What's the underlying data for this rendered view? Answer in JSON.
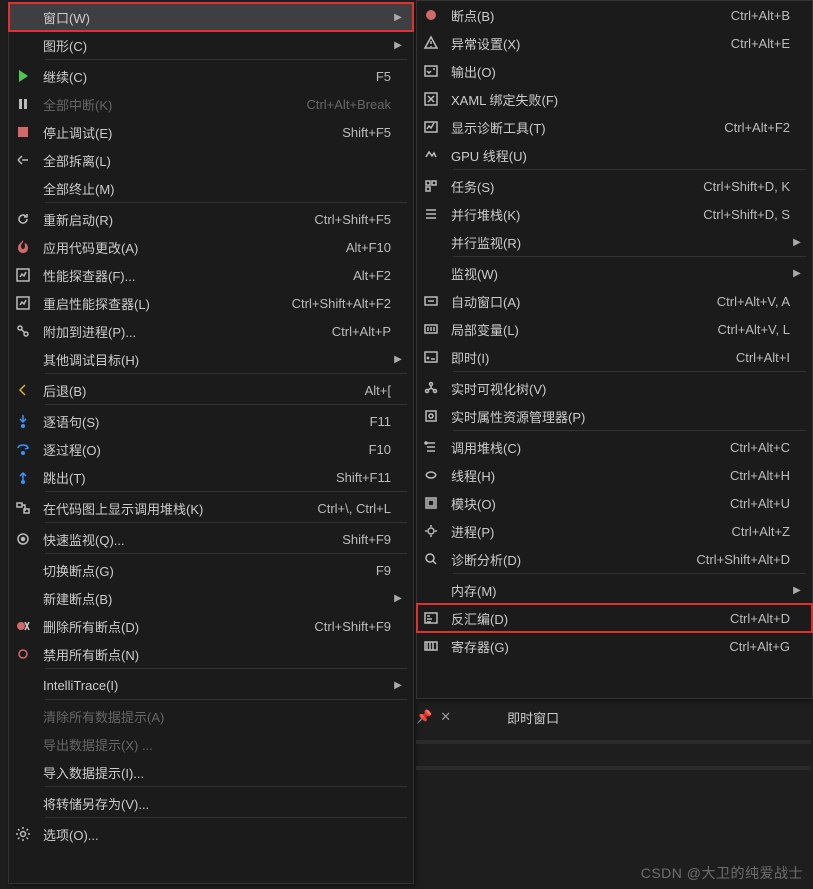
{
  "panel": {
    "title": "即时窗口"
  },
  "watermark": "CSDN @大卫的纯爱战士",
  "leftMenu": [
    {
      "id": "window",
      "label": "窗口(W)",
      "shortcut": "",
      "arrow": true,
      "icon": "",
      "hover": true,
      "highlight": true,
      "sep": false
    },
    {
      "id": "graphics",
      "label": "图形(C)",
      "shortcut": "",
      "arrow": true,
      "icon": "",
      "sep": true
    },
    {
      "id": "continue",
      "label": "继续(C)",
      "shortcut": "F5",
      "icon": "play-icon",
      "color": "#4EC94E"
    },
    {
      "id": "break-all",
      "label": "全部中断(K)",
      "shortcut": "Ctrl+Alt+Break",
      "icon": "pause-icon",
      "disabled": true
    },
    {
      "id": "stop-debug",
      "label": "停止调试(E)",
      "shortcut": "Shift+F5",
      "icon": "stop-icon",
      "color": "#d16969"
    },
    {
      "id": "detach-all",
      "label": "全部拆离(L)",
      "shortcut": "",
      "icon": "detach-icon"
    },
    {
      "id": "terminate-all",
      "label": "全部终止(M)",
      "shortcut": "",
      "icon": "",
      "sep": true
    },
    {
      "id": "restart",
      "label": "重新启动(R)",
      "shortcut": "Ctrl+Shift+F5",
      "icon": "restart-icon"
    },
    {
      "id": "apply-code",
      "label": "应用代码更改(A)",
      "shortcut": "Alt+F10",
      "icon": "flame-icon",
      "color": "#d16969"
    },
    {
      "id": "perf-profiler",
      "label": "性能探查器(F)...",
      "shortcut": "Alt+F2",
      "icon": "profiler-icon"
    },
    {
      "id": "restart-perf",
      "label": "重启性能探查器(L)",
      "shortcut": "Ctrl+Shift+Alt+F2",
      "icon": "profiler-icon"
    },
    {
      "id": "attach-process",
      "label": "附加到进程(P)...",
      "shortcut": "Ctrl+Alt+P",
      "icon": "attach-icon"
    },
    {
      "id": "other-targets",
      "label": "其他调试目标(H)",
      "shortcut": "",
      "arrow": true,
      "icon": "",
      "sep": true
    },
    {
      "id": "step-back",
      "label": "后退(B)",
      "shortcut": "Alt+[",
      "icon": "back-icon",
      "color": "#d9a93b",
      "sep": true
    },
    {
      "id": "step-into",
      "label": "逐语句(S)",
      "shortcut": "F11",
      "icon": "stepinto-icon",
      "color": "#3794ff"
    },
    {
      "id": "step-over",
      "label": "逐过程(O)",
      "shortcut": "F10",
      "icon": "stepover-icon",
      "color": "#3794ff"
    },
    {
      "id": "step-out",
      "label": "跳出(T)",
      "shortcut": "Shift+F11",
      "icon": "stepout-icon",
      "color": "#3794ff",
      "sep": true
    },
    {
      "id": "show-callstack-map",
      "label": "在代码图上显示调用堆栈(K)",
      "shortcut": "Ctrl+\\, Ctrl+L",
      "icon": "map-icon",
      "sep": true
    },
    {
      "id": "quickwatch",
      "label": "快速监视(Q)...",
      "shortcut": "Shift+F9",
      "icon": "watch-icon",
      "sep": true
    },
    {
      "id": "toggle-bp",
      "label": "切换断点(G)",
      "shortcut": "F9",
      "icon": ""
    },
    {
      "id": "new-bp",
      "label": "新建断点(B)",
      "shortcut": "",
      "arrow": true,
      "icon": ""
    },
    {
      "id": "delete-bp",
      "label": "删除所有断点(D)",
      "shortcut": "Ctrl+Shift+F9",
      "icon": "delete-bp-icon"
    },
    {
      "id": "disable-bp",
      "label": "禁用所有断点(N)",
      "shortcut": "",
      "icon": "disable-bp-icon",
      "sep": true
    },
    {
      "id": "intellitrace",
      "label": "IntelliTrace(I)",
      "shortcut": "",
      "arrow": true,
      "icon": "",
      "sep": true
    },
    {
      "id": "clear-tips",
      "label": "清除所有数据提示(A)",
      "shortcut": "",
      "icon": "",
      "disabled": true
    },
    {
      "id": "export-tips",
      "label": "导出数据提示(X) ...",
      "shortcut": "",
      "icon": "",
      "disabled": true
    },
    {
      "id": "import-tips",
      "label": "导入数据提示(I)...",
      "shortcut": "",
      "icon": "",
      "sep": true
    },
    {
      "id": "save-dump",
      "label": "将转储另存为(V)...",
      "shortcut": "",
      "icon": "",
      "sep": true
    },
    {
      "id": "options",
      "label": "选项(O)...",
      "shortcut": "",
      "icon": "gear-icon"
    }
  ],
  "rightMenu": [
    {
      "id": "breakpoints",
      "label": "断点(B)",
      "shortcut": "Ctrl+Alt+B",
      "icon": "bp-icon",
      "color": "#d16969"
    },
    {
      "id": "exception-settings",
      "label": "异常设置(X)",
      "shortcut": "Ctrl+Alt+E",
      "icon": "exception-icon"
    },
    {
      "id": "output",
      "label": "输出(O)",
      "shortcut": "",
      "icon": "output-icon"
    },
    {
      "id": "xaml-bind-fail",
      "label": "XAML 绑定失败(F)",
      "shortcut": "",
      "icon": "xaml-icon"
    },
    {
      "id": "diag-tools",
      "label": "显示诊断工具(T)",
      "shortcut": "Ctrl+Alt+F2",
      "icon": "diag-icon"
    },
    {
      "id": "gpu-threads",
      "label": "GPU 线程(U)",
      "shortcut": "",
      "icon": "gpu-icon",
      "sep": true
    },
    {
      "id": "tasks",
      "label": "任务(S)",
      "shortcut": "Ctrl+Shift+D, K",
      "icon": "tasks-icon"
    },
    {
      "id": "parallel-stacks",
      "label": "并行堆栈(K)",
      "shortcut": "Ctrl+Shift+D, S",
      "icon": "pstack-icon"
    },
    {
      "id": "parallel-watch",
      "label": "并行监视(R)",
      "shortcut": "",
      "arrow": true,
      "icon": "",
      "sep": true
    },
    {
      "id": "watch",
      "label": "监视(W)",
      "shortcut": "",
      "arrow": true,
      "icon": ""
    },
    {
      "id": "autos",
      "label": "自动窗口(A)",
      "shortcut": "Ctrl+Alt+V, A",
      "icon": "autos-icon"
    },
    {
      "id": "locals",
      "label": "局部变量(L)",
      "shortcut": "Ctrl+Alt+V, L",
      "icon": "locals-icon"
    },
    {
      "id": "immediate",
      "label": "即时(I)",
      "shortcut": "Ctrl+Alt+I",
      "icon": "immediate-icon",
      "sep": true
    },
    {
      "id": "live-vtree",
      "label": "实时可视化树(V)",
      "shortcut": "",
      "icon": "vtree-icon"
    },
    {
      "id": "live-prop",
      "label": "实时属性资源管理器(P)",
      "shortcut": "",
      "icon": "prop-icon",
      "sep": true
    },
    {
      "id": "callstack",
      "label": "调用堆栈(C)",
      "shortcut": "Ctrl+Alt+C",
      "icon": "callstack-icon"
    },
    {
      "id": "threads",
      "label": "线程(H)",
      "shortcut": "Ctrl+Alt+H",
      "icon": "threads-icon"
    },
    {
      "id": "modules",
      "label": "模块(O)",
      "shortcut": "Ctrl+Alt+U",
      "icon": "modules-icon"
    },
    {
      "id": "processes",
      "label": "进程(P)",
      "shortcut": "Ctrl+Alt+Z",
      "icon": "processes-icon"
    },
    {
      "id": "diag-analysis",
      "label": "诊断分析(D)",
      "shortcut": "Ctrl+Shift+Alt+D",
      "icon": "analysis-icon",
      "sep": true
    },
    {
      "id": "memory",
      "label": "内存(M)",
      "shortcut": "",
      "arrow": true,
      "icon": ""
    },
    {
      "id": "disassembly",
      "label": "反汇编(D)",
      "shortcut": "Ctrl+Alt+D",
      "icon": "disasm-icon",
      "highlight": true
    },
    {
      "id": "registers",
      "label": "寄存器(G)",
      "shortcut": "Ctrl+Alt+G",
      "icon": "registers-icon"
    }
  ]
}
